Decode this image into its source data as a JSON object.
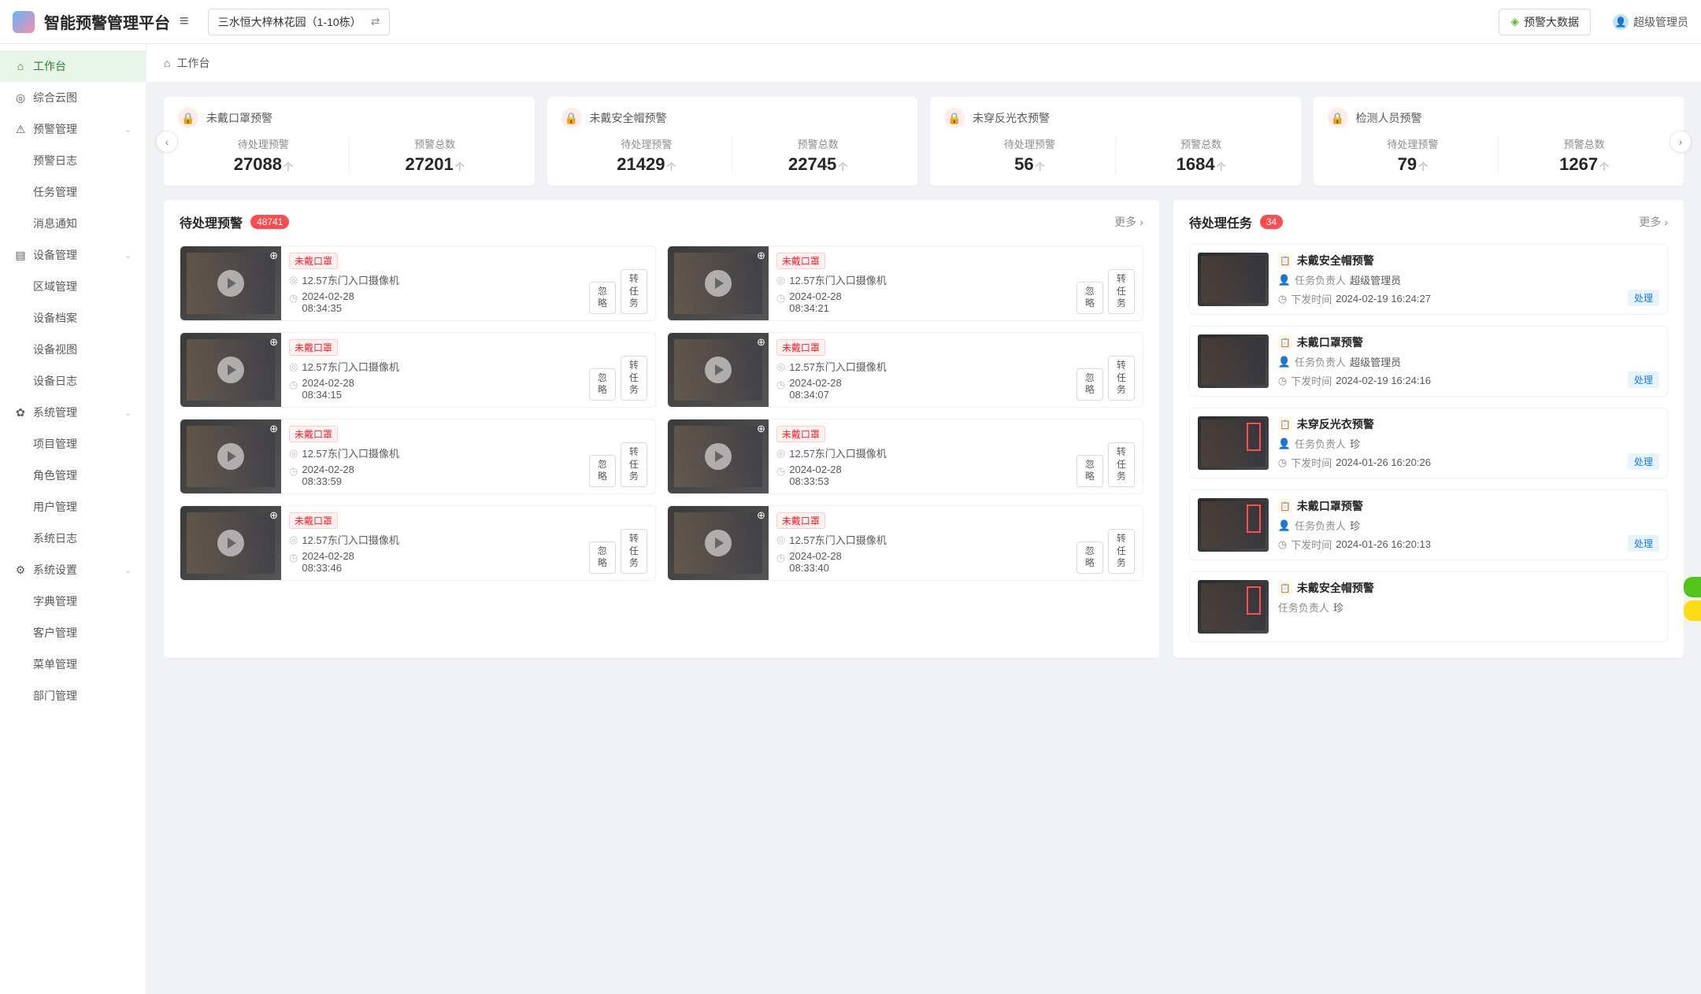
{
  "header": {
    "app_title": "智能预警管理平台",
    "location": "三水恒大梓林花园（1-10栋）",
    "bigdata_label": "预警大数据",
    "user_name": "超级管理员"
  },
  "breadcrumb": {
    "label": "工作台"
  },
  "sidebar": [
    {
      "ico": "⌂",
      "label": "工作台",
      "active": true
    },
    {
      "ico": "◎",
      "label": "综合云图"
    },
    {
      "ico": "⚠",
      "label": "预警管理",
      "expandable": true,
      "children": [
        {
          "label": "预警日志"
        },
        {
          "label": "任务管理"
        },
        {
          "label": "消息通知"
        }
      ]
    },
    {
      "ico": "▤",
      "label": "设备管理",
      "expandable": true,
      "children": [
        {
          "label": "区域管理"
        },
        {
          "label": "设备档案"
        },
        {
          "label": "设备视图"
        },
        {
          "label": "设备日志"
        }
      ]
    },
    {
      "ico": "✿",
      "label": "系统管理",
      "expandable": true,
      "children": [
        {
          "label": "项目管理"
        },
        {
          "label": "角色管理"
        },
        {
          "label": "用户管理"
        },
        {
          "label": "系统日志"
        }
      ]
    },
    {
      "ico": "⚙",
      "label": "系统设置",
      "expandable": true,
      "children": [
        {
          "label": "字典管理"
        },
        {
          "label": "客户管理"
        },
        {
          "label": "菜单管理"
        },
        {
          "label": "部门管理"
        }
      ]
    }
  ],
  "stats": {
    "pending_label": "待处理预警",
    "total_label": "预警总数",
    "unit": "个",
    "cards": [
      {
        "title": "未戴口罩预警",
        "pending": "27088",
        "total": "27201"
      },
      {
        "title": "未戴安全帽预警",
        "pending": "21429",
        "total": "22745"
      },
      {
        "title": "未穿反光衣预警",
        "pending": "56",
        "total": "1684"
      },
      {
        "title": "检测人员预警",
        "pending": "79",
        "total": "1267"
      }
    ]
  },
  "alerts_panel": {
    "title": "待处理预警",
    "count": "48741",
    "more": "更多",
    "ignore": "忽略",
    "transfer": "转任务",
    "items": [
      {
        "tag": "未戴口罩",
        "camera": "12.57东门入口摄像机",
        "date": "2024-02-28",
        "time": "08:34:35"
      },
      {
        "tag": "未戴口罩",
        "camera": "12.57东门入口摄像机",
        "date": "2024-02-28",
        "time": "08:34:21"
      },
      {
        "tag": "未戴口罩",
        "camera": "12.57东门入口摄像机",
        "date": "2024-02-28",
        "time": "08:34:15"
      },
      {
        "tag": "未戴口罩",
        "camera": "12.57东门入口摄像机",
        "date": "2024-02-28",
        "time": "08:34:07"
      },
      {
        "tag": "未戴口罩",
        "camera": "12.57东门入口摄像机",
        "date": "2024-02-28",
        "time": "08:33:59"
      },
      {
        "tag": "未戴口罩",
        "camera": "12.57东门入口摄像机",
        "date": "2024-02-28",
        "time": "08:33:53"
      },
      {
        "tag": "未戴口罩",
        "camera": "12.57东门入口摄像机",
        "date": "2024-02-28",
        "time": "08:33:46"
      },
      {
        "tag": "未戴口罩",
        "camera": "12.57东门入口摄像机",
        "date": "2024-02-28",
        "time": "08:33:40"
      }
    ]
  },
  "tasks_panel": {
    "title": "待处理任务",
    "count": "34",
    "more": "更多",
    "owner_label": "任务负责人",
    "sent_label": "下发时间",
    "process": "处理",
    "items": [
      {
        "title": "未戴安全帽预警",
        "owner": "超级管理员",
        "time": "2024-02-19 16:24:27",
        "hl": false
      },
      {
        "title": "未戴口罩预警",
        "owner": "超级管理员",
        "time": "2024-02-19 16:24:16",
        "hl": false
      },
      {
        "title": "未穿反光衣预警",
        "owner": "珍",
        "time": "2024-01-26 16:20:26",
        "hl": true
      },
      {
        "title": "未戴口罩预警",
        "owner": "珍",
        "time": "2024-01-26 16:20:13",
        "hl": true
      },
      {
        "title": "未戴安全帽预警",
        "owner": "珍",
        "time": "",
        "hl": true,
        "partial": true
      }
    ]
  }
}
